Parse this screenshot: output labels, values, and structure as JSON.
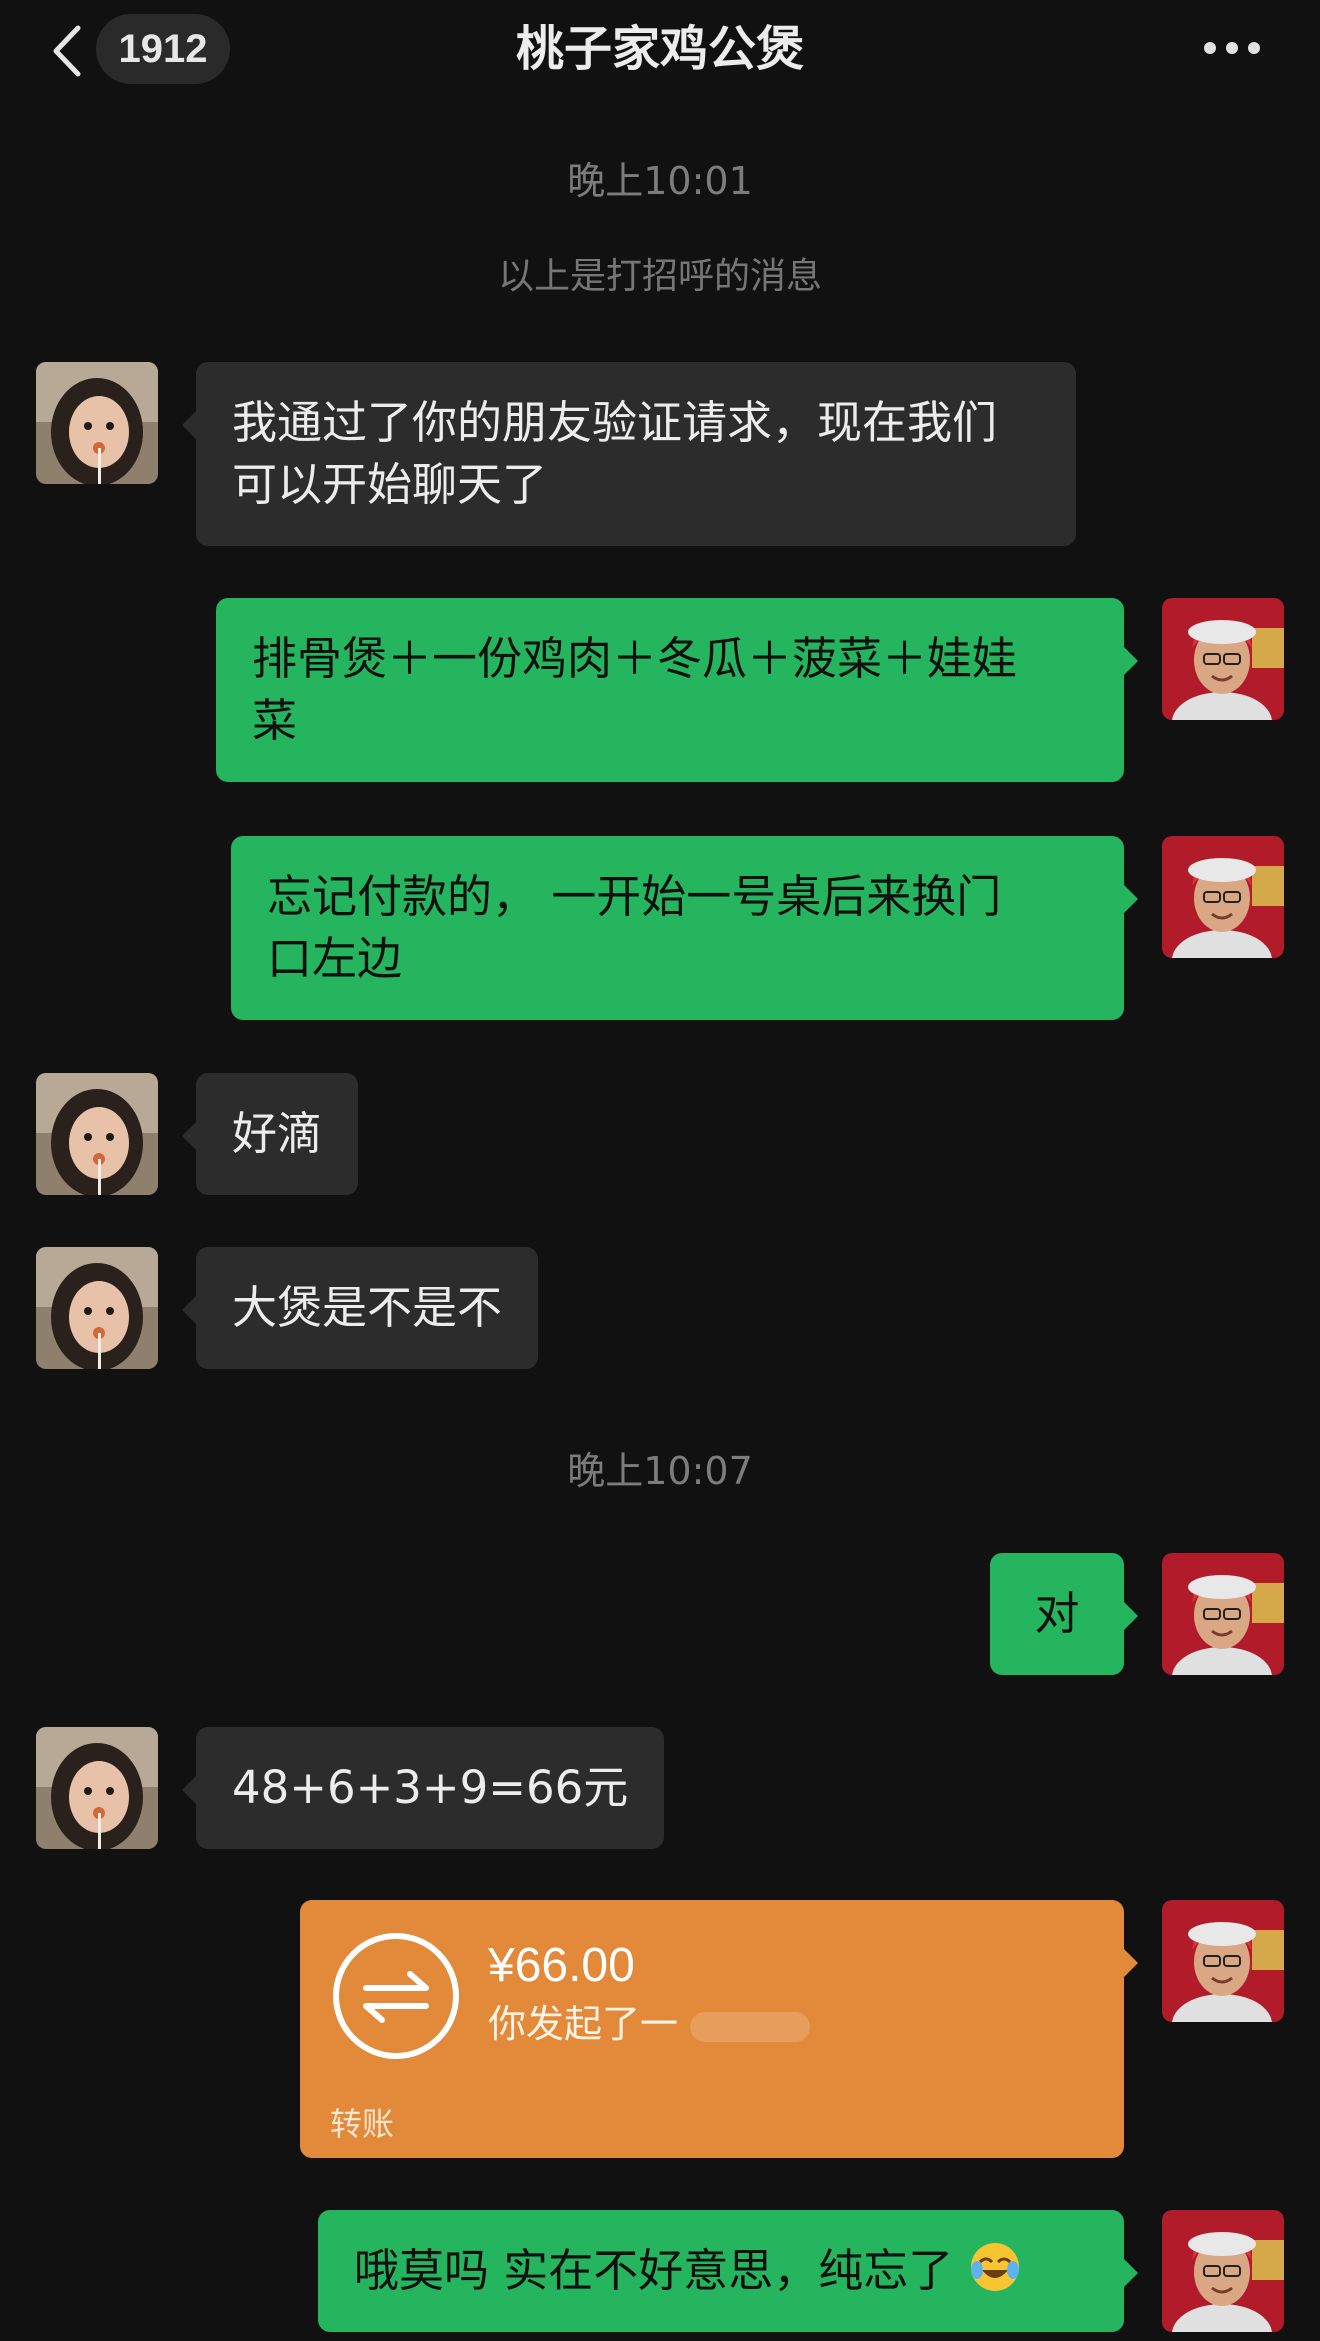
{
  "header": {
    "back_icon": "chevron-left-icon",
    "unread_count": "1912",
    "title": "桃子家鸡公煲",
    "more_icon": "more-dots-icon"
  },
  "timestamps": {
    "first": "晚上10:01",
    "second": "晚上10:07"
  },
  "system_notice": "以上是打招呼的消息",
  "messages": [
    {
      "sender": "contact",
      "text": "我通过了你的朋友验证请求，现在我们可以开始聊天了"
    },
    {
      "sender": "me",
      "line1": "排骨煲＋一份鸡肉＋冬瓜＋菠菜＋娃娃",
      "line2": "菜"
    },
    {
      "sender": "me",
      "line1": "忘记付款的， 一开始一号桌后来换门",
      "line2": "口左边"
    },
    {
      "sender": "contact",
      "text": "好滴"
    },
    {
      "sender": "contact",
      "text": "大煲是不是不"
    },
    {
      "sender": "me",
      "text": "对"
    },
    {
      "sender": "contact",
      "text": "48+6+3+9=66元"
    },
    {
      "sender": "me",
      "type": "transfer",
      "amount": "¥66.00",
      "desc": "你发起了一",
      "kind": "转账",
      "icon": "transfer-arrows-icon"
    },
    {
      "sender": "me",
      "text": "哦莫吗 实在不好意思，纯忘了",
      "emoji": "laughing-crying-emoji-icon"
    }
  ],
  "colors": {
    "background": "#111111",
    "incoming_bubble": "#2c2c2c",
    "outgoing_bubble": "#25b55f",
    "transfer_card": "#e2893a"
  }
}
